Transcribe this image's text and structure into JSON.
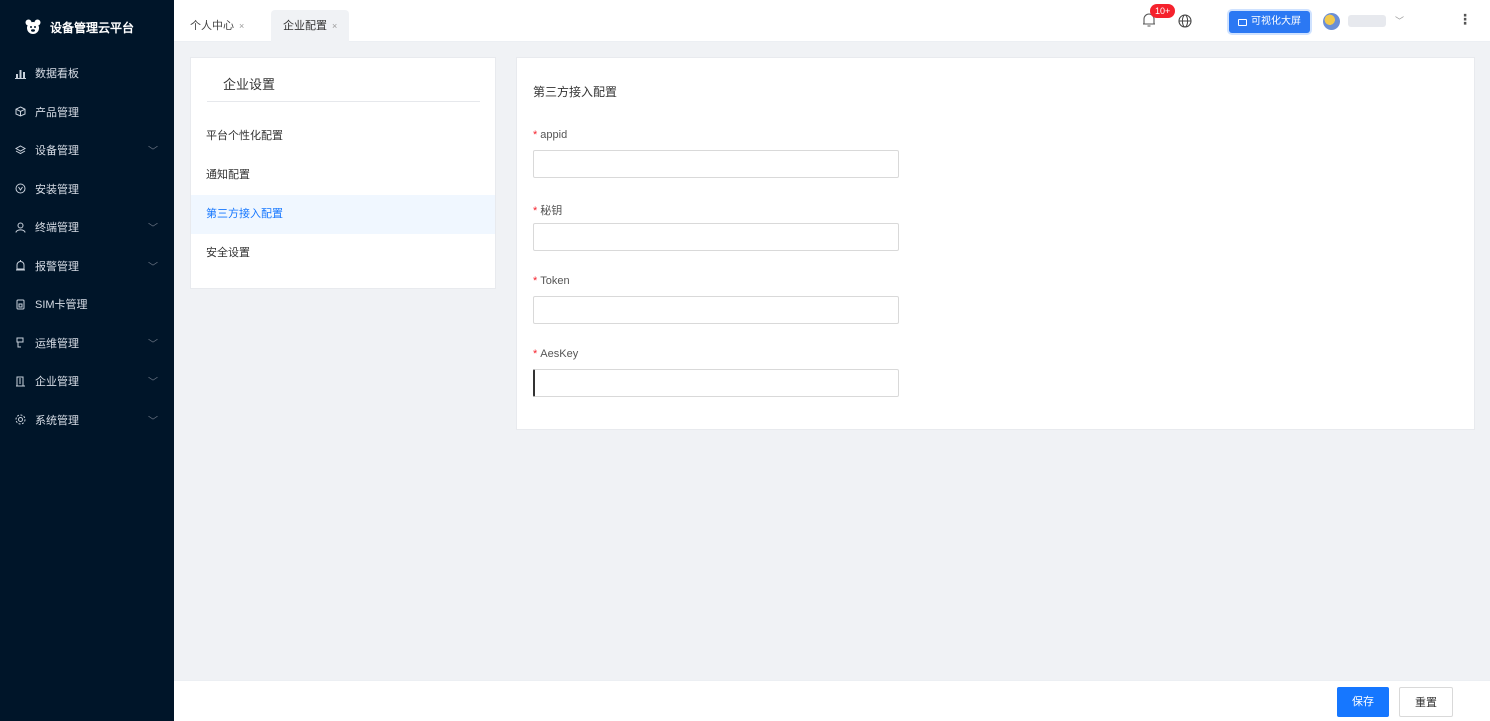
{
  "app": {
    "title": "设备管理云平台"
  },
  "sidebar": {
    "items": [
      {
        "label": "数据看板",
        "icon": "bar-chart-icon",
        "expandable": false
      },
      {
        "label": "产品管理",
        "icon": "box-icon",
        "expandable": false
      },
      {
        "label": "设备管理",
        "icon": "layers-icon",
        "expandable": true
      },
      {
        "label": "安装管理",
        "icon": "tool-icon",
        "expandable": false
      },
      {
        "label": "终端管理",
        "icon": "user-icon",
        "expandable": true
      },
      {
        "label": "报警管理",
        "icon": "alarm-icon",
        "expandable": true
      },
      {
        "label": "SIM卡管理",
        "icon": "sim-card-icon",
        "expandable": false
      },
      {
        "label": "运维管理",
        "icon": "maintenance-icon",
        "expandable": true
      },
      {
        "label": "企业管理",
        "icon": "building-icon",
        "expandable": true
      },
      {
        "label": "系统管理",
        "icon": "settings-icon",
        "expandable": true
      }
    ]
  },
  "header": {
    "tabs": [
      {
        "label": "个人中心",
        "active": false
      },
      {
        "label": "企业配置",
        "active": true
      }
    ],
    "notification_badge": "10+",
    "visualization_button": "可视化大屏",
    "colors": {
      "accent": "#1677ff",
      "badge": "#f5222d",
      "sidebar_bg": "#001529"
    }
  },
  "settings_nav": {
    "title": "企业设置",
    "items": [
      {
        "label": "平台个性化配置",
        "active": false
      },
      {
        "label": "通知配置",
        "active": false
      },
      {
        "label": "第三方接入配置",
        "active": true
      },
      {
        "label": "安全设置",
        "active": false
      }
    ]
  },
  "form": {
    "title": "第三方接入配置",
    "required_mark": "*",
    "fields": [
      {
        "label": "appid",
        "value": ""
      },
      {
        "label": "秘钥",
        "value": ""
      },
      {
        "label": "Token",
        "value": ""
      },
      {
        "label": "AesKey",
        "value": ""
      }
    ]
  },
  "footer": {
    "save_label": "保存",
    "reset_label": "重置"
  }
}
